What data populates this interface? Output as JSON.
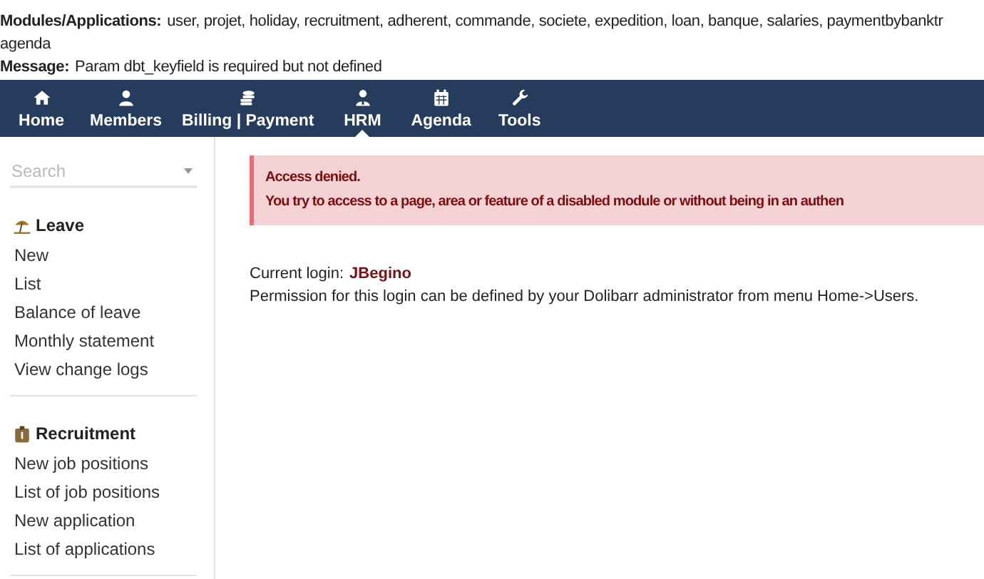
{
  "info_lines": [
    {
      "label": "Modules/Applications:",
      "text": "user, projet, holiday, recruitment, adherent, commande, societe, expedition, loan, banque, salaries, paymentbybanktr",
      "continuation": "agenda"
    },
    {
      "label": "Message:",
      "text": "Param dbt_keyfield is required but not defined"
    }
  ],
  "nav": [
    {
      "label": "Home",
      "selected": false
    },
    {
      "label": "Members",
      "selected": false
    },
    {
      "label": "Billing | Payment",
      "selected": false
    },
    {
      "label": "HRM",
      "selected": true
    },
    {
      "label": "Agenda",
      "selected": false
    },
    {
      "label": "Tools",
      "selected": false
    }
  ],
  "sidebar": {
    "search": {
      "placeholder": "Search"
    },
    "sections": [
      {
        "title": "Leave",
        "items": [
          "New",
          "List",
          "Balance of leave",
          "Monthly statement",
          "View change logs"
        ]
      },
      {
        "title": "Recruitment",
        "items": [
          "New job positions",
          "List of job positions",
          "New application",
          "List of applications"
        ]
      }
    ]
  },
  "alert": {
    "title": "Access denied.",
    "text": "You try to access to a page, area or feature of a disabled module or without being in an authen"
  },
  "login": {
    "label": "Current login:",
    "value": "JBegino",
    "note": "Permission for this login can be defined by your Dolibarr administrator from menu Home->Users."
  }
}
